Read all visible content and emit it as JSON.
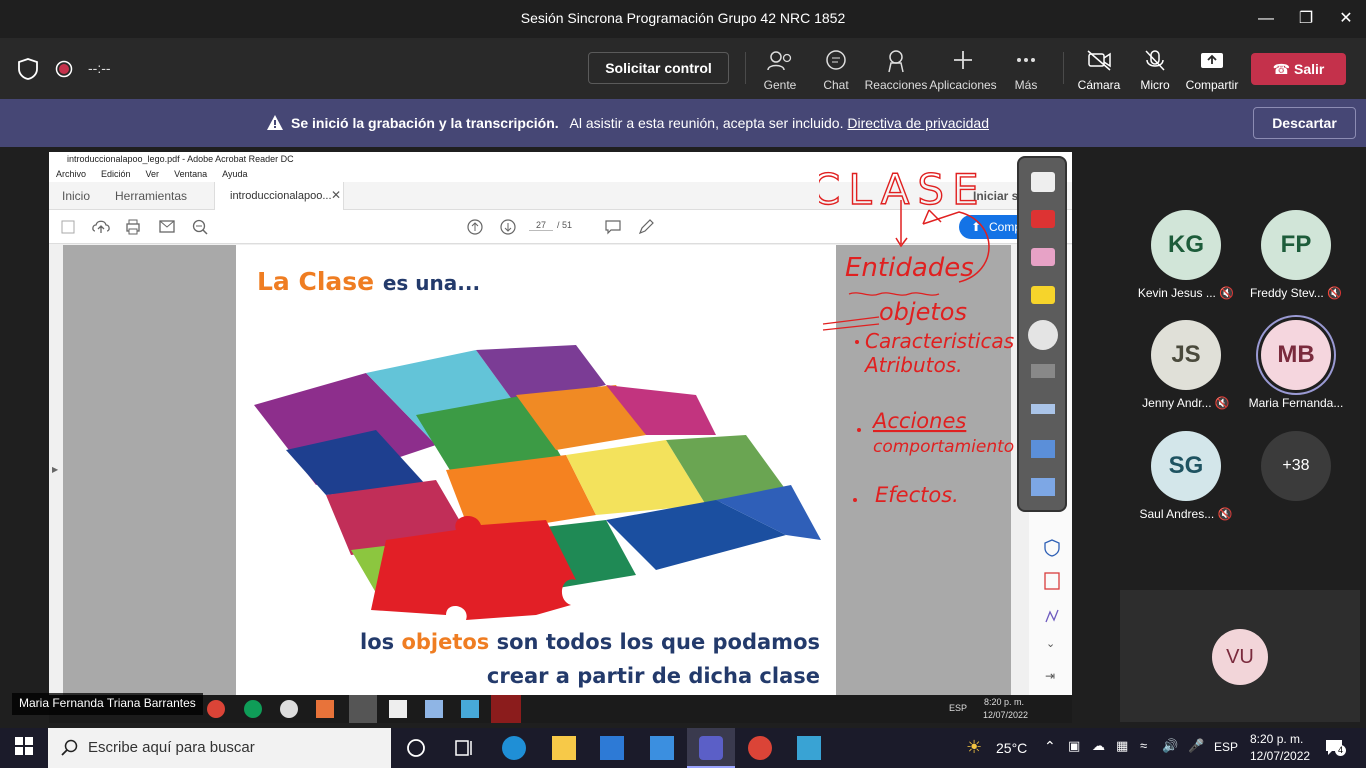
{
  "window": {
    "title": "Sesión Sincrona Programación Grupo 42 NRC 1852"
  },
  "toolbar": {
    "timer": "--:--",
    "request_control": "Solicitar control",
    "buttons": [
      {
        "label": "Gente"
      },
      {
        "label": "Chat"
      },
      {
        "label": "Reacciones"
      },
      {
        "label": "Aplicaciones"
      },
      {
        "label": "Más"
      },
      {
        "label": "Cámara"
      },
      {
        "label": "Micro"
      },
      {
        "label": "Compartir"
      }
    ],
    "leave": "Salir"
  },
  "banner": {
    "bold": "Se inició la grabación y la transcripción.",
    "text": "Al asistir a esta reunión, acepta ser incluido.",
    "link": "Directiva de privacidad",
    "dismiss": "Descartar"
  },
  "acrobat": {
    "title": "introduccionalapoo_lego.pdf - Adobe Acrobat Reader DC",
    "menu": [
      "Archivo",
      "Edición",
      "Ver",
      "Ventana",
      "Ayuda"
    ],
    "tabs": [
      "Inicio",
      "Herramientas",
      "introduccionalapoo..."
    ],
    "signin": "Iniciar sesión",
    "share": "Compartir",
    "page_current": "27",
    "page_total": "/ 51"
  },
  "slide": {
    "title_accent": "La Clase",
    "title_rest": "es una...",
    "caption_pre": "los",
    "caption_accent": "objetos",
    "caption_post": "son todos los que podamos",
    "caption_line2": "crear a partir de dicha clase"
  },
  "annotations": {
    "word1": "CLASE",
    "word2": "Entidades",
    "word3": "objetos",
    "bullet1": "Caracteristicas",
    "bullet1b": "Atributos.",
    "bullet2": "Acciones",
    "bullet2b": "comportamiento",
    "bullet3": "Efectos."
  },
  "presenter": "Maria Fernanda Triana Barrantes",
  "inner_clock": {
    "time": "8:20 p. m.",
    "date": "12/07/2022",
    "lang": "ESP"
  },
  "participants": [
    {
      "initials": "KG",
      "name": "Kevin Jesus ...",
      "bg": "#d1e5d8",
      "fg": "#1d5c3a"
    },
    {
      "initials": "FP",
      "name": "Freddy Stev...",
      "bg": "#d1e5d8",
      "fg": "#1d5c3a"
    },
    {
      "initials": "JS",
      "name": "Jenny Andr...",
      "bg": "#e0e0d8",
      "fg": "#4a4a3c"
    },
    {
      "initials": "MB",
      "name": "Maria Fernanda...",
      "bg": "#f5d6de",
      "fg": "#7a2b3d"
    },
    {
      "initials": "SG",
      "name": "Saul Andres...",
      "bg": "#d3e6ea",
      "fg": "#1e5361"
    },
    {
      "initials": "+38",
      "name": "",
      "bg": "#3b3b3b",
      "fg": "#ffffff"
    }
  ],
  "self_view": {
    "initials": "VU"
  },
  "windows": {
    "search": "Escribe aquí para buscar",
    "weather": "25°C",
    "lang": "ESP",
    "time": "8:20 p. m.",
    "date": "12/07/2022",
    "notifications": "4"
  }
}
